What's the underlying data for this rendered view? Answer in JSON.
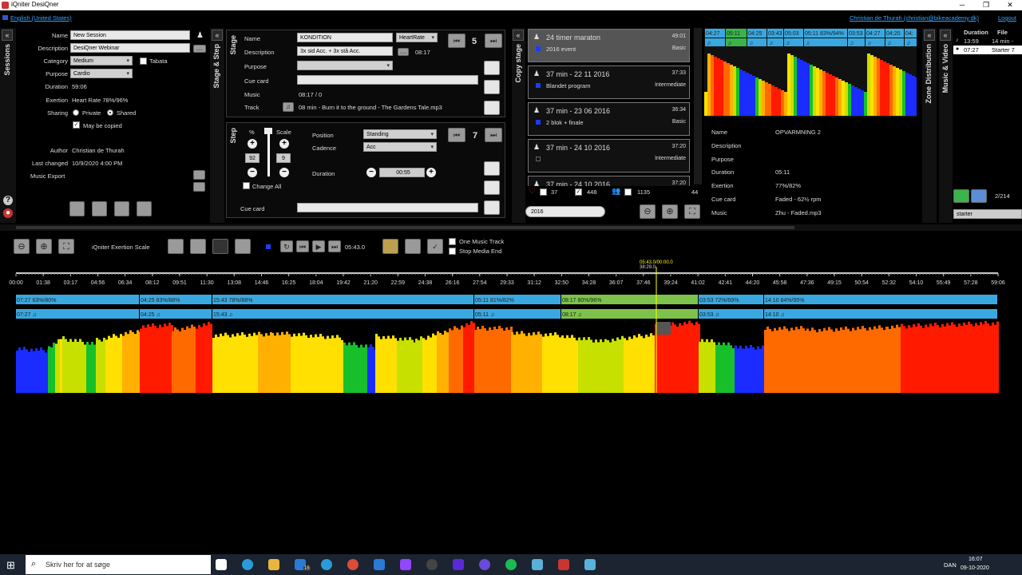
{
  "window": {
    "title": "iQniter DesiQner"
  },
  "menubar": {
    "language": "English (United States)",
    "user": "Christian de Thurah  (christian@bikeacademy.dk)",
    "logout": "Logout"
  },
  "sessions": {
    "tab": "Sessions",
    "name_label": "Name",
    "name": "New Session",
    "description_label": "Description",
    "description": "DesiQner Webinar",
    "category_label": "Category",
    "category": "Medium",
    "tabata": "Tabata",
    "purpose_label": "Purpose",
    "purpose": "Cardio",
    "duration_label": "Duration",
    "duration": "59:06",
    "exertion_label": "Exertion",
    "exertion": "Heart Rate  78%/96%",
    "sharing_label": "Sharing",
    "private": "Private",
    "shared": "Shared",
    "copy": "May be copied",
    "author_label": "Author",
    "author": "Christian de Thurah",
    "last_changed_label": "Last changed",
    "last_changed": "10/9/2020 4:00 PM",
    "music_export_label": "Music Export"
  },
  "stage": {
    "tab": "Stage & Step",
    "stage_tab": "Stage",
    "name_label": "Name",
    "name": "KONDITION",
    "type": "HeartRate",
    "number": "5",
    "description_label": "Description",
    "description": "3x sid Acc. + 3x stå Acc.",
    "duration": "08:17",
    "purpose_label": "Purpose",
    "cue_label": "Cue card",
    "music_label": "Music",
    "music_value": "08:17  /  0",
    "track_label": "Track",
    "track": "08 min - Burn it to the ground - The Gardens Tale.mp3"
  },
  "step": {
    "tab": "Step",
    "percent": "%",
    "scale": "Scale",
    "percent_val": "92",
    "scale_val": "9",
    "change_all": "Change All",
    "position_label": "Position",
    "position": "Standing",
    "cadence_label": "Cadence",
    "cadence": "Acc",
    "number": "7",
    "duration_label": "Duration",
    "duration": "00:55",
    "cue_label": "Cue card"
  },
  "copy_stage": {
    "tab": "Copy stage",
    "items": [
      {
        "title": "24 timer maraton",
        "time": "49:01",
        "sub": "2016 event",
        "level": "Basic",
        "color": "#1a3cff"
      },
      {
        "title": "37 min - 22 11 2016",
        "time": "37:33",
        "sub": "Blandet program",
        "level": "Intermediate",
        "color": "#1a3cff"
      },
      {
        "title": "37 min - 23 06 2016",
        "time": "36:34",
        "sub": "2 blok + finale",
        "level": "Basic",
        "color": "#1a3cff"
      },
      {
        "title": "37 min - 24 10 2016",
        "time": "37:20",
        "sub": "",
        "level": "Intermediate",
        "color": ""
      },
      {
        "title": "37 min - 24 10 2016",
        "time": "37:20",
        "sub": "",
        "level": "",
        "color": ""
      }
    ],
    "count1": "37",
    "count2": "448",
    "count3": "1135",
    "count4": "44",
    "search": "2016"
  },
  "preview": {
    "labels": [
      "04:27",
      "05:11",
      "04:25",
      "03:43",
      "05:03",
      "05:11 83%/94%",
      "03:53",
      "04:27",
      "04:20",
      "04:"
    ],
    "name_label": "Name",
    "name": "OPVARMNING 2",
    "description_label": "Description",
    "purpose_label": "Purpose",
    "duration_label": "Duration",
    "duration": "05:11",
    "exertion_label": "Exertion",
    "exertion": "77%/82%",
    "cue_label": "Cue card",
    "cue": "Faded - 62½ rpm",
    "music_label": "Music",
    "music": "Zhu - Faded.mp3"
  },
  "zone": {
    "tab": "Zone Distribution"
  },
  "music_video": {
    "tab": "Music & Video",
    "col_duration": "Duration",
    "col_file": "File",
    "rows": [
      {
        "d": "13:59",
        "f": "14 min -"
      },
      {
        "d": "07:27",
        "f": "Starter 7"
      }
    ],
    "count": "2/214",
    "search": "starter"
  },
  "toolbar": {
    "scale_label": "iQniter Exertion Scale",
    "time": "05:43.0",
    "one_music": "One Music Track",
    "stop_media": "Stop Media End"
  },
  "timeline": {
    "cursor": "05:43.0/00:00.0",
    "cursor2": "38:29.0",
    "ticks": [
      "00:00",
      "01:38",
      "03:17",
      "04:56",
      "06:34",
      "08:12",
      "09:51",
      "11:30",
      "13:08",
      "14:46",
      "16:25",
      "18:04",
      "19:42",
      "21:20",
      "22:59",
      "24:38",
      "26:16",
      "27:54",
      "29:33",
      "31:12",
      "32:50",
      "34:28",
      "36:07",
      "37:46",
      "39:24",
      "41:02",
      "42:41",
      "44:20",
      "45:58",
      "47:36",
      "49:15",
      "50:54",
      "52:32",
      "54:10",
      "55:49",
      "57:28",
      "59:06"
    ],
    "stages": [
      "07:27 63%/80%",
      "04:25 83%/88%",
      "15:43 78%/88%",
      "05:11 81%/82%",
      "08:17 80%/96%",
      "03:53 72%/69%",
      "14:10 84%/95%"
    ],
    "music": [
      "07:27 ♫",
      "04:25 ♫",
      "15:43 ♫",
      "05:11 ♫",
      "08:17 ♫",
      "03:53 ♫",
      "14:10 ♫"
    ]
  },
  "taskbar": {
    "search": "Skriv her for at søge",
    "lang": "DAN",
    "time": "16:07",
    "date": "09-10-2020",
    "badge": "15"
  }
}
